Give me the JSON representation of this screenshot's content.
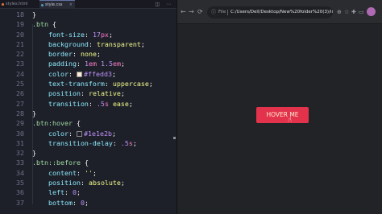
{
  "editor": {
    "tabs": [
      {
        "label": "styles.html",
        "active": false
      },
      {
        "label": "style.css",
        "active": true
      }
    ],
    "actions": "◫ ⋯",
    "lines": [
      {
        "n": "18",
        "tokens": [
          {
            "c": "pun",
            "t": "}"
          }
        ]
      },
      {
        "n": "19",
        "tokens": [
          {
            "c": "sel",
            "t": ".btn"
          },
          {
            "c": "pun",
            "t": " {"
          }
        ]
      },
      {
        "n": "20",
        "tokens": [
          {
            "c": "prop",
            "t": "    font-size"
          },
          {
            "c": "pun",
            "t": ": "
          },
          {
            "c": "num",
            "t": "17"
          },
          {
            "c": "unit",
            "t": "px"
          },
          {
            "c": "pun",
            "t": ";"
          }
        ]
      },
      {
        "n": "21",
        "tokens": [
          {
            "c": "prop",
            "t": "    background"
          },
          {
            "c": "pun",
            "t": ": "
          },
          {
            "c": "val",
            "t": "transparent"
          },
          {
            "c": "pun",
            "t": ";"
          }
        ]
      },
      {
        "n": "22",
        "tokens": [
          {
            "c": "prop",
            "t": "    border"
          },
          {
            "c": "pun",
            "t": ": "
          },
          {
            "c": "val",
            "t": "none"
          },
          {
            "c": "pun",
            "t": ";"
          }
        ]
      },
      {
        "n": "23",
        "tokens": [
          {
            "c": "prop",
            "t": "    padding"
          },
          {
            "c": "pun",
            "t": ": "
          },
          {
            "c": "num",
            "t": "1"
          },
          {
            "c": "unit",
            "t": "em"
          },
          {
            "c": "pun",
            "t": " "
          },
          {
            "c": "num",
            "t": "1.5"
          },
          {
            "c": "unit",
            "t": "em"
          },
          {
            "c": "pun",
            "t": ";"
          }
        ]
      },
      {
        "n": "24",
        "tokens": [
          {
            "c": "prop",
            "t": "    color"
          },
          {
            "c": "pun",
            "t": ": "
          },
          {
            "c": "swatch",
            "t": "#ffedd3"
          },
          {
            "c": "num",
            "t": "#ffedd3"
          },
          {
            "c": "pun",
            "t": ";"
          }
        ]
      },
      {
        "n": "25",
        "tokens": [
          {
            "c": "prop",
            "t": "    text-transform"
          },
          {
            "c": "pun",
            "t": ": "
          },
          {
            "c": "val",
            "t": "uppercase"
          },
          {
            "c": "pun",
            "t": ";"
          }
        ]
      },
      {
        "n": "26",
        "tokens": [
          {
            "c": "prop",
            "t": "    position"
          },
          {
            "c": "pun",
            "t": ": "
          },
          {
            "c": "val",
            "t": "relative"
          },
          {
            "c": "pun",
            "t": ";"
          }
        ]
      },
      {
        "n": "27",
        "tokens": [
          {
            "c": "prop",
            "t": "    transition"
          },
          {
            "c": "pun",
            "t": ": "
          },
          {
            "c": "num",
            "t": ".5"
          },
          {
            "c": "unit",
            "t": "s"
          },
          {
            "c": "pun",
            "t": " "
          },
          {
            "c": "val",
            "t": "ease"
          },
          {
            "c": "pun",
            "t": ";"
          }
        ]
      },
      {
        "n": "28",
        "tokens": [
          {
            "c": "pun",
            "t": "}"
          }
        ]
      },
      {
        "n": "29",
        "tokens": [
          {
            "c": "sel",
            "t": ".btn:hover"
          },
          {
            "c": "pun",
            "t": " {"
          }
        ]
      },
      {
        "n": "30",
        "tokens": [
          {
            "c": "prop",
            "t": "    color"
          },
          {
            "c": "pun",
            "t": ": "
          },
          {
            "c": "swatch",
            "t": "#1e1e2b"
          },
          {
            "c": "num",
            "t": "#1e1e2b"
          },
          {
            "c": "pun",
            "t": ";"
          }
        ]
      },
      {
        "n": "31",
        "tokens": [
          {
            "c": "prop",
            "t": "    transition-delay"
          },
          {
            "c": "pun",
            "t": ": "
          },
          {
            "c": "num",
            "t": ".5"
          },
          {
            "c": "unit",
            "t": "s"
          },
          {
            "c": "pun",
            "t": ";"
          }
        ]
      },
      {
        "n": "32",
        "tokens": [
          {
            "c": "pun",
            "t": "}"
          }
        ]
      },
      {
        "n": "33",
        "tokens": [
          {
            "c": "sel",
            "t": ".btn::before"
          },
          {
            "c": "pun",
            "t": " {"
          }
        ]
      },
      {
        "n": "34",
        "tokens": [
          {
            "c": "prop",
            "t": "    content"
          },
          {
            "c": "pun",
            "t": ": "
          },
          {
            "c": "val",
            "t": "''"
          },
          {
            "c": "pun",
            "t": ";"
          }
        ]
      },
      {
        "n": "35",
        "tokens": [
          {
            "c": "prop",
            "t": "    position"
          },
          {
            "c": "pun",
            "t": ": "
          },
          {
            "c": "val",
            "t": "absolute"
          },
          {
            "c": "pun",
            "t": ";"
          }
        ]
      },
      {
        "n": "36",
        "tokens": [
          {
            "c": "prop",
            "t": "    left"
          },
          {
            "c": "pun",
            "t": ": "
          },
          {
            "c": "num",
            "t": "0"
          },
          {
            "c": "pun",
            "t": ";"
          }
        ]
      },
      {
        "n": "37",
        "tokens": [
          {
            "c": "prop",
            "t": "    bottom"
          },
          {
            "c": "pun",
            "t": ": "
          },
          {
            "c": "num",
            "t": "0"
          },
          {
            "c": "pun",
            "t": ";"
          }
        ]
      }
    ]
  },
  "browser": {
    "nav": {
      "back": "←",
      "forward": "→",
      "reload": "⟳"
    },
    "address": {
      "info": "ⓘ",
      "scheme": "File",
      "url": "C:/Users/Dell/Desktop/New%20folder%20(3)/in..."
    },
    "icons": {
      "zoom": "⊕",
      "star": "☆",
      "extensions": "✚",
      "sidebar": "▭"
    },
    "demo_button_label": "Hover me",
    "demo_button_color": "#e3324b",
    "demo_text_color": "#ffedd3"
  }
}
